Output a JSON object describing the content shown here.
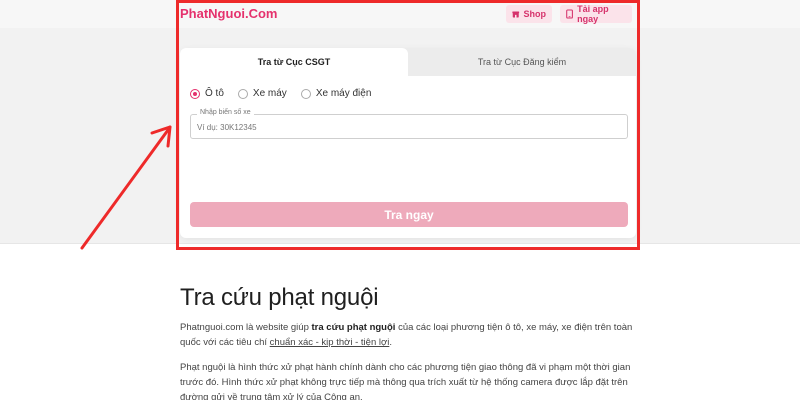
{
  "header": {
    "logo": "PhatNguoi.Com",
    "shop_label": "Shop",
    "app_label": "Tải app ngay"
  },
  "form": {
    "tabs": [
      {
        "label": "Tra từ Cục CSGT",
        "active": true
      },
      {
        "label": "Tra từ Cục Đăng kiểm",
        "active": false
      }
    ],
    "vehicle_types": [
      {
        "label": "Ô tô",
        "checked": true
      },
      {
        "label": "Xe máy",
        "checked": false
      },
      {
        "label": "Xe máy điện",
        "checked": false
      }
    ],
    "plate_label": "Nhập biển số xe",
    "plate_placeholder": "Ví dụ: 30K12345",
    "plate_value": "",
    "submit_label": "Tra ngay"
  },
  "article": {
    "title": "Tra cứu phạt nguội",
    "p1_start": "Phatnguoi.com là website giúp ",
    "p1_bold": "tra cứu phạt nguội",
    "p1_mid": " của các loại phương tiện ô tô, xe máy, xe điện trên toàn quốc với các tiêu chí ",
    "p1_underline": "chuẩn xác - kịp thời - tiện lợi",
    "p1_end": ".",
    "p2": "Phạt nguội là hình thức xử phạt hành chính dành cho các phương tiện giao thông đã vi phạm một thời gian trước đó. Hình thức xử phạt không trực tiếp mà thông qua trích xuất từ hệ thống camera được lắp đặt trên đường gửi về trung tâm xử lý của Công an."
  },
  "colors": {
    "brand": "#e5316d",
    "button": "#eeaabb",
    "annotation": "#ee2a2a"
  }
}
